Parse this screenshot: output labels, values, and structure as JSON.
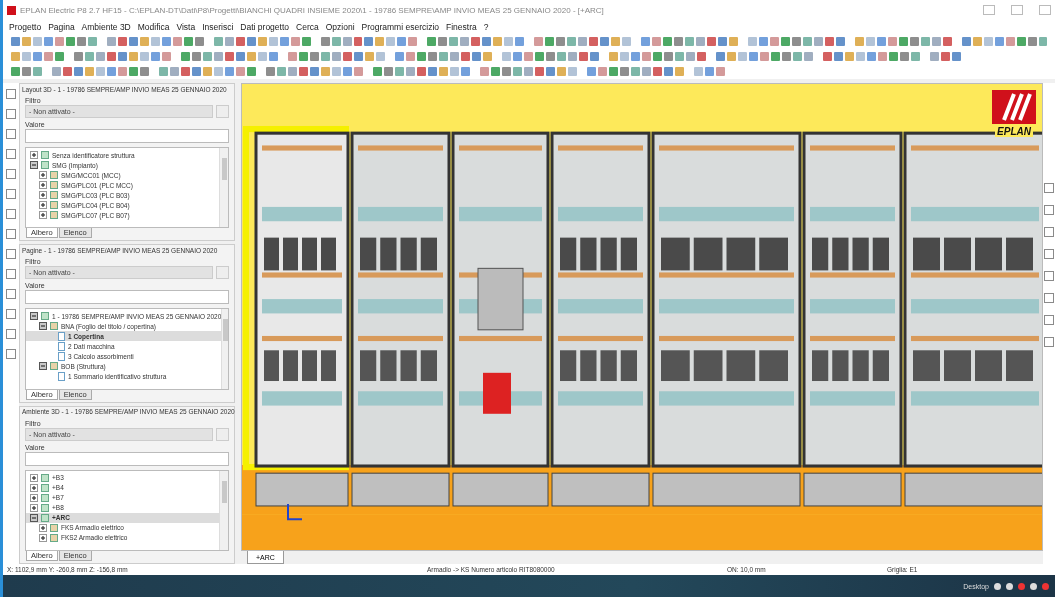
{
  "window": {
    "title": "EPLAN Electric P8 2.7 HF15 - C:\\EPLAN-DT\\Dati\\P8\\Progetti\\BIANCHI QUADRI INSIEME 2020\\1 - 19786 SEMPRE\\AMP INVIO MEAS 25 GENNAIO 2020 - [+ARC]"
  },
  "menu": [
    "Progetto",
    "Pagina",
    "Ambiente 3D",
    "Modifica",
    "Vista",
    "Inserisci",
    "Dati progetto",
    "Cerca",
    "Opzioni",
    "Programmi esercizio",
    "Finestra",
    "?"
  ],
  "panels": [
    {
      "title": "Layout 3D - 1 - 19786 SEMPRE/AMP INVIO MEAS 25 GENNAIO 2020",
      "filter_label": "Filtro",
      "filter_value": "- Non attivato -",
      "value_label": "Valore",
      "tree": [
        {
          "label": "Senza identificatore struttura",
          "kind": "node",
          "expanded": false,
          "selected": false
        },
        {
          "label": "SMG (Impianto)",
          "kind": "node",
          "expanded": true,
          "selected": false,
          "children": [
            {
              "label": "SMG/MCC01 (MCC)",
              "kind": "node",
              "expanded": false,
              "selected": false
            },
            {
              "label": "SMG/PLC01 (PLC MCC)",
              "kind": "node",
              "expanded": false,
              "selected": false
            },
            {
              "label": "SMG/PLC03 (PLC B03)",
              "kind": "node",
              "expanded": false,
              "selected": false
            },
            {
              "label": "SMG/PLC04 (PLC B04)",
              "kind": "node",
              "expanded": false,
              "selected": false
            },
            {
              "label": "SMG/PLC07 (PLC B07)",
              "kind": "node",
              "expanded": false,
              "selected": false
            }
          ]
        }
      ],
      "tabs": [
        {
          "label": "Albero",
          "selected": true
        },
        {
          "label": "Elenco",
          "selected": false
        }
      ]
    },
    {
      "title": "Pagine - 1 - 19786 SEMPRE/AMP INVIO MEAS 25 GENNAIO 2020",
      "filter_label": "Filtro",
      "filter_value": "- Non attivato -",
      "value_label": "Valore",
      "tree": [
        {
          "label": "1 - 19786 SEMPRE/AMP INVIO MEAS 25 GENNAIO 2020",
          "kind": "node",
          "expanded": true,
          "selected": false,
          "children": [
            {
              "label": "BNA (Foglio del titolo / copertina)",
              "kind": "node",
              "expanded": true,
              "selected": false,
              "children": [
                {
                  "label": "1 Copertina",
                  "kind": "leaf",
                  "selected": true
                },
                {
                  "label": "2 Dati macchina",
                  "kind": "leaf",
                  "selected": false
                },
                {
                  "label": "3 Calcolo assorbimenti",
                  "kind": "leaf",
                  "selected": false
                }
              ]
            },
            {
              "label": "BOB (Struttura)",
              "kind": "node",
              "expanded": true,
              "selected": false,
              "children": [
                {
                  "label": "1 Sommario identificativo struttura",
                  "kind": "leaf",
                  "selected": false
                }
              ]
            }
          ]
        }
      ],
      "tabs": [
        {
          "label": "Albero",
          "selected": true
        },
        {
          "label": "Elenco",
          "selected": false
        }
      ]
    },
    {
      "title": "Ambiente 3D - 1 - 19786 SEMPRE/AMP INVIO MEAS 25 GENNAIO 2020",
      "filter_label": "Filtro",
      "filter_value": "- Non attivato -",
      "value_label": "Valore",
      "tree": [
        {
          "label": "+B3",
          "kind": "node",
          "expanded": false,
          "selected": false
        },
        {
          "label": "+B4",
          "kind": "node",
          "expanded": false,
          "selected": false
        },
        {
          "label": "+B7",
          "kind": "node",
          "expanded": false,
          "selected": false
        },
        {
          "label": "+B8",
          "kind": "node",
          "expanded": false,
          "selected": false
        },
        {
          "label": "+ARC",
          "kind": "node",
          "expanded": true,
          "selected": true,
          "children": [
            {
              "label": "FKS Armadio elettrico",
              "kind": "node",
              "expanded": false,
              "selected": false
            },
            {
              "label": "FKS2 Armadio elettrico",
              "kind": "node",
              "expanded": false,
              "selected": false
            }
          ]
        }
      ],
      "tabs": [
        {
          "label": "Albero",
          "selected": true
        },
        {
          "label": "Elenco",
          "selected": false
        }
      ]
    }
  ],
  "logo": {
    "text": "EPLAN"
  },
  "document_tabs": [
    {
      "label": "+ARC",
      "selected": true
    }
  ],
  "status_bar": {
    "coordinates": "X: 1102,9 mm  Y: -260,8 mm  Z: -156,8 mm",
    "object": "Armadio -> KS Numero articolo RIT8080000",
    "snap": "ON: 10,0 mm",
    "grid": "Griglia: E1"
  },
  "taskbar": {
    "label": "Desktop"
  }
}
